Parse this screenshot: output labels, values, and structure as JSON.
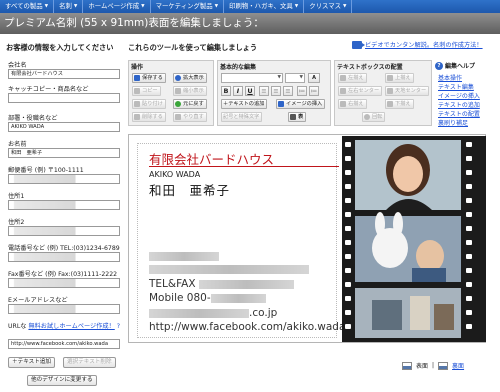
{
  "nav": {
    "items": [
      {
        "label": "すべての製品",
        "dropdown": true
      },
      {
        "label": "名刺",
        "dropdown": true
      },
      {
        "label": "ホームページ作成",
        "dropdown": true
      },
      {
        "label": "マーケティング製品",
        "dropdown": true
      },
      {
        "label": "印刷物・ハガキ、文具",
        "dropdown": true
      },
      {
        "label": "クリスマス",
        "dropdown": true
      }
    ]
  },
  "title": "プレミアム名刺 (55 x 91mm)表面を編集しましょう：",
  "form": {
    "heading": "お客様の情報を入力してください",
    "fields": [
      {
        "label": "会社名",
        "value": "有限会社バードハウス"
      },
      {
        "label": "キャッチコピー・商品名など",
        "value": ""
      },
      {
        "label": "部署・役職名など",
        "value": "AKIKO WADA"
      },
      {
        "label": "お名前",
        "value": "和田　亜希子"
      },
      {
        "label": "郵便番号 (例) 〒100-1111",
        "value": ""
      },
      {
        "label": "住所1",
        "value": ""
      },
      {
        "label": "住所2",
        "value": ""
      },
      {
        "label": "電話番号など (例) TEL:(03)1234-6789",
        "value": ""
      },
      {
        "label": "Fax番号など (例) Fax:(03)1111-2222",
        "value": ""
      },
      {
        "label": "Eメールアドレスなど",
        "value": ""
      }
    ],
    "url_label": "URLな",
    "url_link": "無料お試しホームページ作成！",
    "url_help": "?",
    "url_value": "http://www.facebook.com/akiko.wada",
    "add_text_button": "＋テキスト追加",
    "delete_text_button": "選択テキスト削除",
    "other_design_button": "他のデザインに変更する"
  },
  "tools": {
    "heading": "これらのツールを使って編集しましょう",
    "video_link": "ビデオでカンタン解説。名刺の作成方法！",
    "operations": {
      "title": "操作",
      "save": "保存する",
      "zoom": "拡大表示",
      "copy": "コピー",
      "shrink": "縮小表示",
      "paste": "貼り付け",
      "restore": "元に戻す",
      "delete": "削除する",
      "redo": "やり直す"
    },
    "basic": {
      "title": "基本的な編集",
      "bold": "B",
      "italic": "I",
      "underline": "U",
      "add_text": "＋テキストの追加",
      "insert_image": "イメージの挿入",
      "symbols": "記号と特殊文字",
      "table": "表"
    },
    "align": {
      "title": "テキストボックスの配置",
      "left": "左揃え",
      "top": "上揃え",
      "center_h": "左右センター",
      "center_v": "天地センター",
      "right": "右揃え",
      "bottom": "下揃え",
      "rotate": "回転"
    },
    "help": {
      "title": "編集ヘルプ",
      "links": [
        "基本操作",
        "テキスト編集",
        "イメージの挿入",
        "テキストの追加",
        "テキストの配置",
        "裏刷り補足"
      ]
    }
  },
  "card": {
    "company": "有限会社バードハウス",
    "roman_name": "AKIKO WADA",
    "name": "和田　亜希子",
    "tel": "TEL&FAX",
    "mobile": "Mobile 080-",
    "mail_suffix": ".co.jp",
    "url": "http://www.facebook.com/akiko.wada"
  },
  "footer": {
    "front": "表面",
    "back": "裏面"
  },
  "colors": {
    "nav_blue": "#2563c0",
    "accent_red": "#c0151b",
    "link_blue": "#1a4fd6"
  }
}
